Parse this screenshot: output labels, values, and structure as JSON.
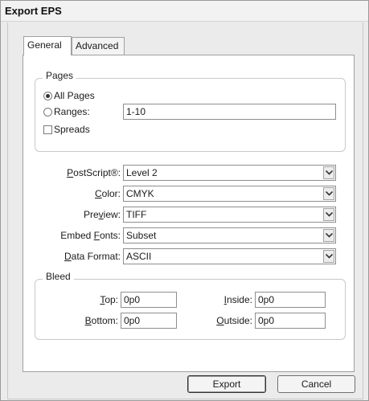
{
  "window": {
    "title": "Export EPS"
  },
  "tabs": [
    {
      "label": "General",
      "active": true
    },
    {
      "label": "Advanced",
      "active": false
    }
  ],
  "pages": {
    "legend": "Pages",
    "all_pages_label": "All Pages",
    "all_pages_selected": true,
    "ranges_label": "Ranges:",
    "ranges_selected": false,
    "ranges_value": "1-10",
    "spreads_label": "Spreads",
    "spreads_checked": false
  },
  "fields": [
    {
      "label": "PostScript®:",
      "value": "Level 2"
    },
    {
      "label": "Color:",
      "value": "CMYK"
    },
    {
      "label": "Preview:",
      "value": "TIFF"
    },
    {
      "label": "Embed Fonts:",
      "value": "Subset"
    },
    {
      "label": "Data Format:",
      "value": "ASCII"
    }
  ],
  "bleed": {
    "legend": "Bleed",
    "top_label": "Top:",
    "top_value": "0p0",
    "bottom_label": "Bottom:",
    "bottom_value": "0p0",
    "inside_label": "Inside:",
    "inside_value": "0p0",
    "outside_label": "Outside:",
    "outside_value": "0p0"
  },
  "buttons": {
    "export_label": "Export",
    "cancel_label": "Cancel"
  },
  "icons": {
    "dropdown": "chevron-down-icon"
  }
}
